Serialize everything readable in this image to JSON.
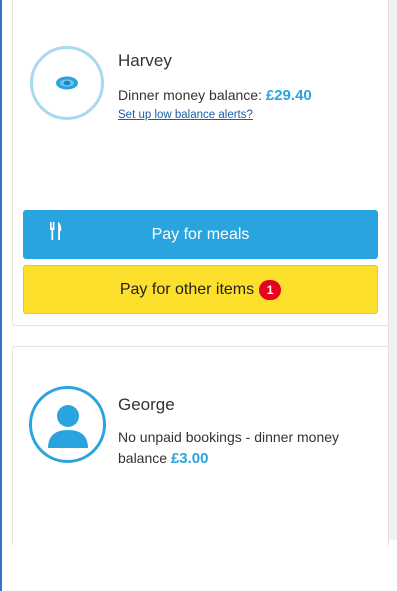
{
  "children": [
    {
      "name": "Harvey",
      "balance_prefix": "Dinner money balance: ",
      "balance_amount": "£29.40",
      "alerts_link": "Set up low balance alerts?",
      "avatar_icon": "pacifier-icon",
      "pay_meals_label": "Pay for meals",
      "pay_meals_icon": "fork-knife-icon",
      "pay_other_label": "Pay for other items",
      "pay_other_badge": "1"
    },
    {
      "name": "George",
      "balance_prefix": "No unpaid bookings - dinner money balance ",
      "balance_amount": "£3.00",
      "avatar_icon": "person-icon"
    }
  ],
  "colors": {
    "accent": "#2aa4df",
    "secondary_button": "#fde02b",
    "badge": "#e8001c",
    "link": "#1b5fa8"
  }
}
